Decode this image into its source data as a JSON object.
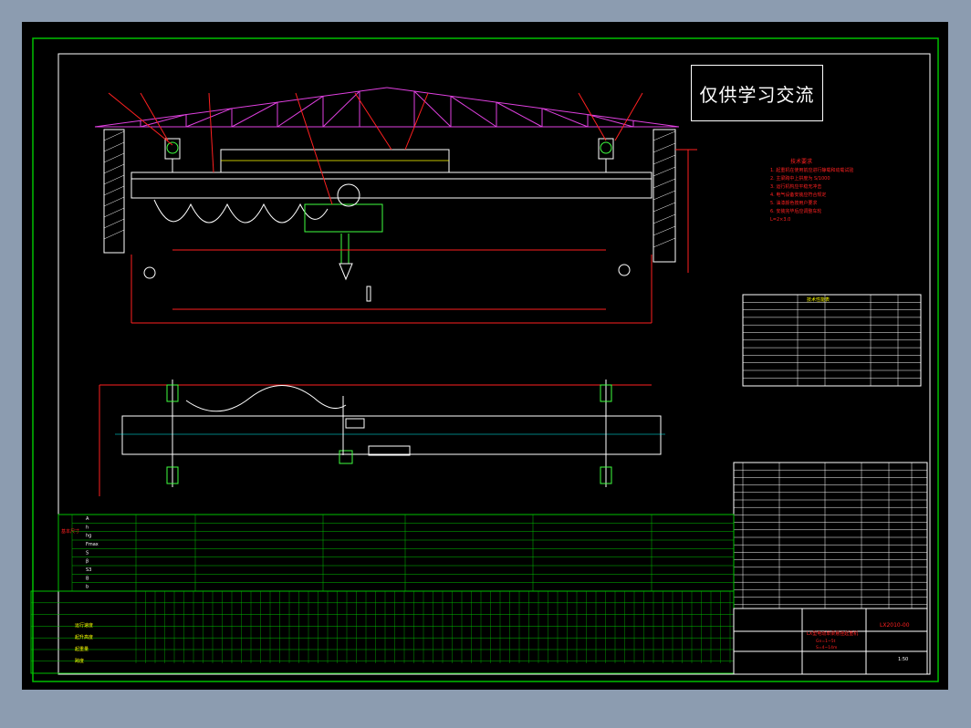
{
  "watermark": "仅供学习交流",
  "notes": {
    "title": "技术要求",
    "lines": [
      "1. 起重机在使用前应进行静载和动载试验",
      "2. 主梁跨中上拱度为 S/1000",
      "3. 运行机构应平稳无冲击",
      "4. 电气设备安装应符合规定",
      "5. 油漆颜色按用户要求",
      "6. 安装完毕后应调整车轮",
      "L=2×3.0"
    ]
  },
  "tech_table": {
    "title": "技术性能表"
  },
  "title_block": {
    "code": "LX2010-00",
    "name": "LX型电动单梁悬挂起重机",
    "subtitle_lines": [
      "Gn=1~5t",
      "S=4~14m"
    ],
    "scale": "1:50"
  },
  "dims_table": {
    "row_headers": [
      "A",
      "h",
      "hg",
      "Fmax",
      "S",
      "β",
      "S3",
      "B",
      "b"
    ],
    "side_label": "基本尺寸"
  },
  "bottom_rows": [
    "运行速度",
    "起升高度",
    "起重量",
    "跨度"
  ],
  "colors": {
    "frame": "#00c000",
    "truss": "#e040e0",
    "structure": "#ffffff",
    "dimension": "#ff2020",
    "accent": "#00ffff",
    "motor": "#40ff40",
    "text_yellow": "#ffff00"
  }
}
